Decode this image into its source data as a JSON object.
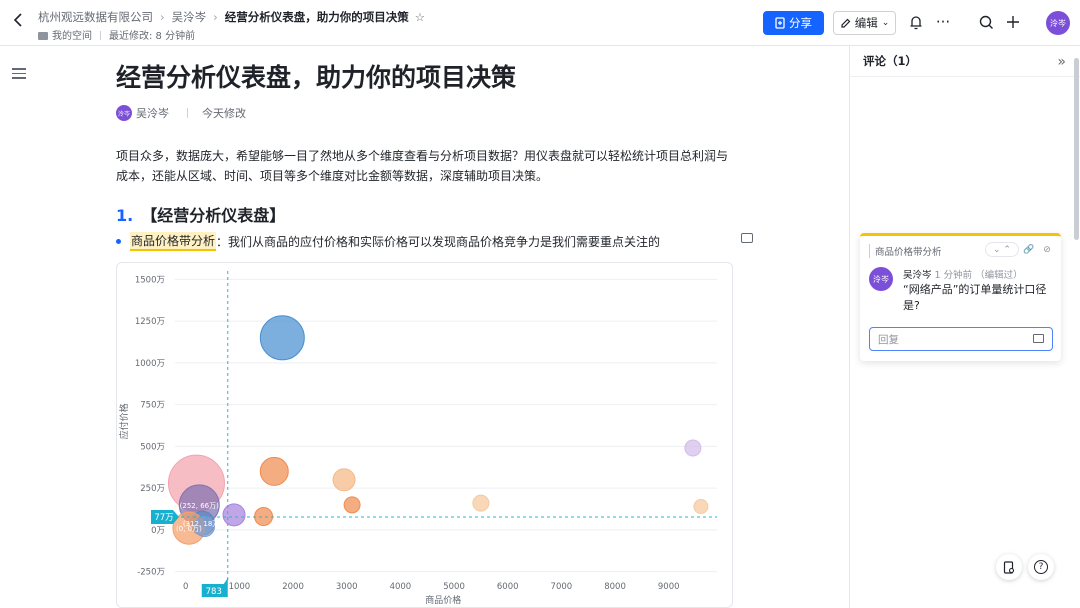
{
  "breadcrumb": {
    "org": "杭州观远数据有限公司",
    "person": "吴泠岑",
    "doc": "经营分析仪表盘，助力你的项目决策"
  },
  "meta": {
    "space": "我的空间",
    "modified": "最近修改: 8 分钟前"
  },
  "toolbar": {
    "share": "分享",
    "edit": "编辑",
    "avatar": "泠岑"
  },
  "doc": {
    "title": "经营分析仪表盘，助力你的项目决策",
    "author": "吴泠岑",
    "author_avatar": "泠岑",
    "modified": "今天修改",
    "para": "项目众多，数据庞大，希望能够一目了然地从多个维度查看与分析项目数据？用仪表盘就可以轻松统计项目总利润与成本，还能从区域、时间、项目等多个维度对比金额等数据，深度辅助项目决策。",
    "heading_num": "1.",
    "heading": "【经营分析仪表盘】",
    "bullet_hl": "商品价格带分析",
    "bullet_rest": "：我们从商品的应付价格和实际价格可以发现商品价格竞争力是我们需要重点关注的"
  },
  "chart_data": {
    "type": "scatter",
    "xlabel": "商品价格",
    "ylabel": "应付价格",
    "xlim": [
      -200,
      9900
    ],
    "ylim": [
      -300,
      1550
    ],
    "x_ticks": [
      {
        "v": 0,
        "label": "0"
      },
      {
        "v": 1000,
        "label": "1000"
      },
      {
        "v": 2000,
        "label": "2000"
      },
      {
        "v": 3000,
        "label": "3000"
      },
      {
        "v": 4000,
        "label": "4000"
      },
      {
        "v": 5000,
        "label": "5000"
      },
      {
        "v": 6000,
        "label": "6000"
      },
      {
        "v": 7000,
        "label": "7000"
      },
      {
        "v": 8000,
        "label": "8000"
      },
      {
        "v": 9000,
        "label": "9000"
      }
    ],
    "y_ticks": [
      {
        "v": 1500,
        "label": "1500万"
      },
      {
        "v": 1250,
        "label": "1250万"
      },
      {
        "v": 1000,
        "label": "1000万"
      },
      {
        "v": 750,
        "label": "750万"
      },
      {
        "v": 500,
        "label": "500万"
      },
      {
        "v": 250,
        "label": "250万"
      },
      {
        "v": 0,
        "label": "0万"
      },
      {
        "v": -250,
        "label": "-250万"
      }
    ],
    "crosshair": {
      "x": 783,
      "y": 77,
      "x_label": "783",
      "y_label": "77万"
    },
    "points": [
      {
        "x": 200,
        "y": 280,
        "r": 28,
        "color": "#f4a3ae",
        "label": ""
      },
      {
        "x": 1800,
        "y": 1150,
        "r": 22,
        "color": "#4a90d0",
        "label": ""
      },
      {
        "x": 1650,
        "y": 350,
        "r": 14,
        "color": "#f08c50",
        "label": ""
      },
      {
        "x": 2950,
        "y": 300,
        "r": 11,
        "color": "#f6b987",
        "label": ""
      },
      {
        "x": 3100,
        "y": 150,
        "r": 8,
        "color": "#f08c50",
        "label": ""
      },
      {
        "x": 5500,
        "y": 160,
        "r": 8,
        "color": "#f6c9a0",
        "label": ""
      },
      {
        "x": 9450,
        "y": 490,
        "r": 8,
        "color": "#d2bdea",
        "label": ""
      },
      {
        "x": 9600,
        "y": 140,
        "r": 7,
        "color": "#f6c9a0",
        "label": ""
      },
      {
        "x": 1450,
        "y": 80,
        "r": 9,
        "color": "#f08c50",
        "label": ""
      },
      {
        "x": 900,
        "y": 90,
        "r": 11,
        "color": "#a884dc",
        "label": ""
      },
      {
        "x": 252,
        "y": 150,
        "r": 20,
        "color": "#8070b0",
        "label": "(252, 66万)"
      },
      {
        "x": 312,
        "y": 40,
        "r": 12,
        "color": "#5a86c0",
        "label": "(312, 18万)"
      },
      {
        "x": 60,
        "y": 10,
        "r": 16,
        "color": "#f4a06a",
        "label": "(0, 0万)"
      },
      {
        "x": 350,
        "y": 20,
        "r": 10,
        "color": "#7f9ed0",
        "label": ""
      }
    ]
  },
  "comments": {
    "header": "评论（1）",
    "quote": "商品价格带分析",
    "author": "吴泠岑",
    "avatar": "泠岑",
    "time": "1 分钟前 （编辑过）",
    "text": "“网络产品”的订单量统计口径是?",
    "reply_placeholder": "回复"
  }
}
